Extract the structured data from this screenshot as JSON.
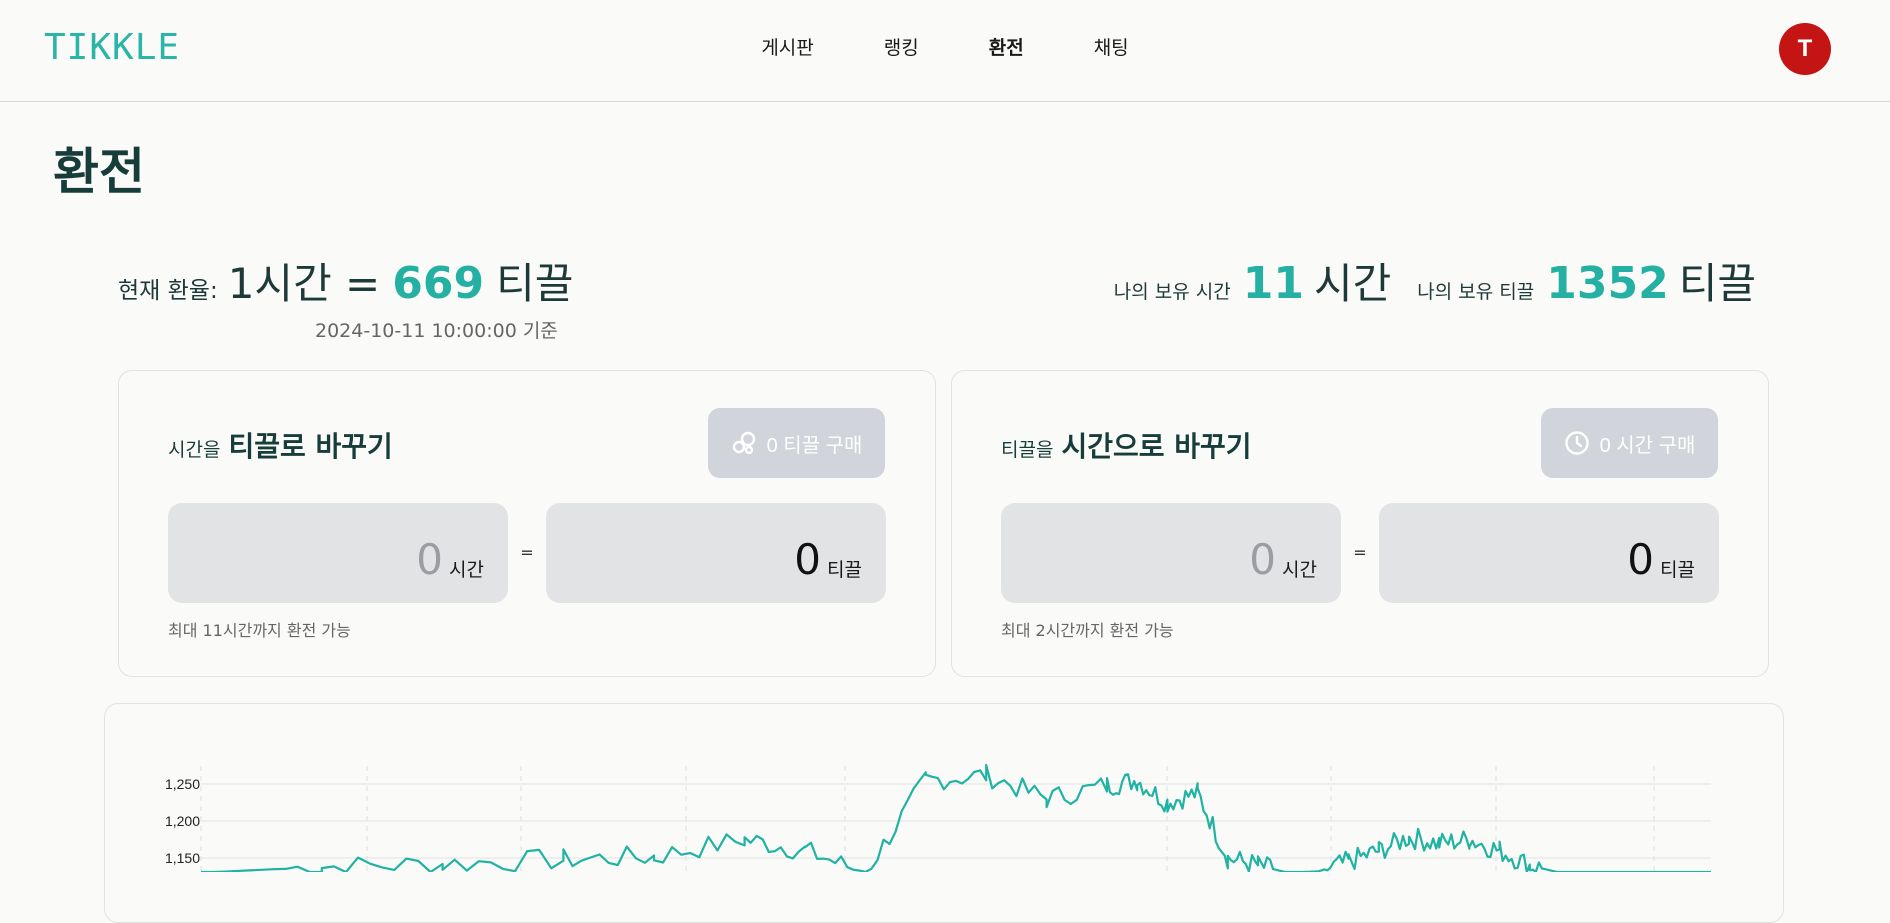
{
  "header": {
    "logo": "TIKKLE",
    "nav": [
      {
        "label": "게시판",
        "active": false
      },
      {
        "label": "랭킹",
        "active": false
      },
      {
        "label": "환전",
        "active": true
      },
      {
        "label": "채팅",
        "active": false
      }
    ],
    "avatar_initial": "T",
    "avatar_color": "#c41414"
  },
  "page_title": "환전",
  "rate": {
    "label": "현재 환율:",
    "left": "1시간 =",
    "value": "669",
    "unit": "티끌",
    "date": "2024-10-11 10:00:00 기준"
  },
  "holdings": {
    "time_label": "나의 보유 시간",
    "time_value": "11",
    "time_unit": "시간",
    "tikkle_label": "나의 보유 티끌",
    "tikkle_value": "1352",
    "tikkle_unit": "티끌"
  },
  "cards": [
    {
      "title_small": "시간을",
      "title_big": "티끌로 바꾸기",
      "button_label": "0 티끌 구매",
      "button_icon": "coins-icon",
      "from_value": "0",
      "from_unit": "시간",
      "to_value": "0",
      "to_unit": "티끌",
      "equals": "=",
      "note": "최대 11시간까지 환전 가능"
    },
    {
      "title_small": "티끌을",
      "title_big": "시간으로 바꾸기",
      "button_label": "0 시간 구매",
      "button_icon": "clock-icon",
      "from_value": "0",
      "from_unit": "시간",
      "to_value": "0",
      "to_unit": "티끌",
      "equals": "=",
      "note": "최대 2시간까지 환전 가능"
    }
  ],
  "colors": {
    "accent": "#24b1a3",
    "title": "#173d3a",
    "button_disabled": "#d1d4da"
  },
  "chart_data": {
    "type": "line",
    "y_ticks": [
      "1,250",
      "1,200",
      "1,150"
    ],
    "ylim": [
      1130,
      1270
    ],
    "grid": true,
    "series": [
      {
        "color": "#20b2a2",
        "x": [
          0,
          8,
          16,
          24,
          30,
          36,
          40,
          44,
          48,
          52,
          56,
          60,
          62,
          64,
          66,
          68,
          70,
          72,
          74,
          76,
          78,
          80,
          82,
          84,
          86,
          88,
          90,
          92,
          94,
          96,
          98,
          100
        ],
        "values": [
          1130,
          1138,
          1142,
          1148,
          1152,
          1175,
          1160,
          1130,
          1255,
          1262,
          1230,
          1248,
          1255,
          1225,
          1238,
          1150,
          1140,
          1130,
          1132,
          1145,
          1160,
          1178,
          1170,
          1175,
          1160,
          1140,
          1130,
          1130,
          1130,
          1130,
          1130,
          1130
        ]
      }
    ]
  }
}
